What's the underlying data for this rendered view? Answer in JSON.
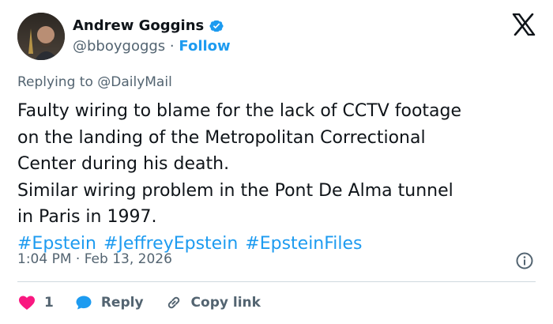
{
  "author": {
    "name": "Andrew Goggins",
    "handle": "@bboygoggs",
    "separator": "·",
    "follow_label": "Follow"
  },
  "replying_to": "Replying to @DailyMail",
  "tweet": {
    "lines": [
      "Faulty wiring to blame for the lack of CCTV footage",
      "on the landing of the Metropolitan Correctional",
      "Center during his death.",
      "Similar wiring problem in the Pont De Alma tunnel",
      "in Paris in 1997."
    ],
    "hashtags": [
      "#Epstein",
      "#JeffreyEpstein",
      "#EpsteinFiles"
    ]
  },
  "timestamp": "1:04 PM · Feb 13, 2026",
  "actions": {
    "like_count": "1",
    "reply_label": "Reply",
    "copy_link_label": "Copy link"
  },
  "colors": {
    "accent": "#1d9bf0",
    "like": "#f91880",
    "text_primary": "#0f1419",
    "text_secondary": "#536471"
  },
  "icons": [
    "verified-badge-icon",
    "x-logo-icon",
    "info-icon",
    "heart-icon",
    "reply-bubble-icon",
    "link-icon"
  ]
}
